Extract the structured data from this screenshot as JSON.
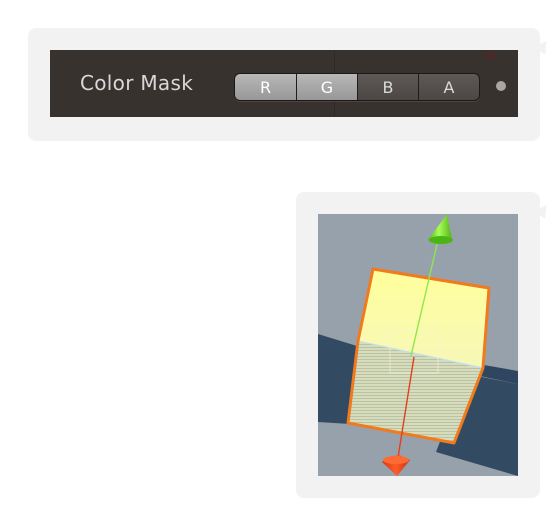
{
  "color_mask": {
    "label": "Color Mask",
    "channels": [
      {
        "label": "R",
        "enabled": true
      },
      {
        "label": "G",
        "enabled": true
      },
      {
        "label": "B",
        "enabled": false
      },
      {
        "label": "A",
        "enabled": false
      }
    ]
  },
  "colors": {
    "panel_background": "#38322f",
    "channel_on": "#a8a8a8",
    "channel_off": "#555050",
    "scene_background": "#97a1ac",
    "cube_top": "#ffffa8",
    "cube_outline": "#f07a1c",
    "shadow": "#334a63",
    "axis_y": "#7fe030",
    "axis_x": "#e0401c"
  },
  "icons": {
    "dot": "circle-indicator",
    "y_handle": "green-cone",
    "x_handle": "red-cone"
  }
}
